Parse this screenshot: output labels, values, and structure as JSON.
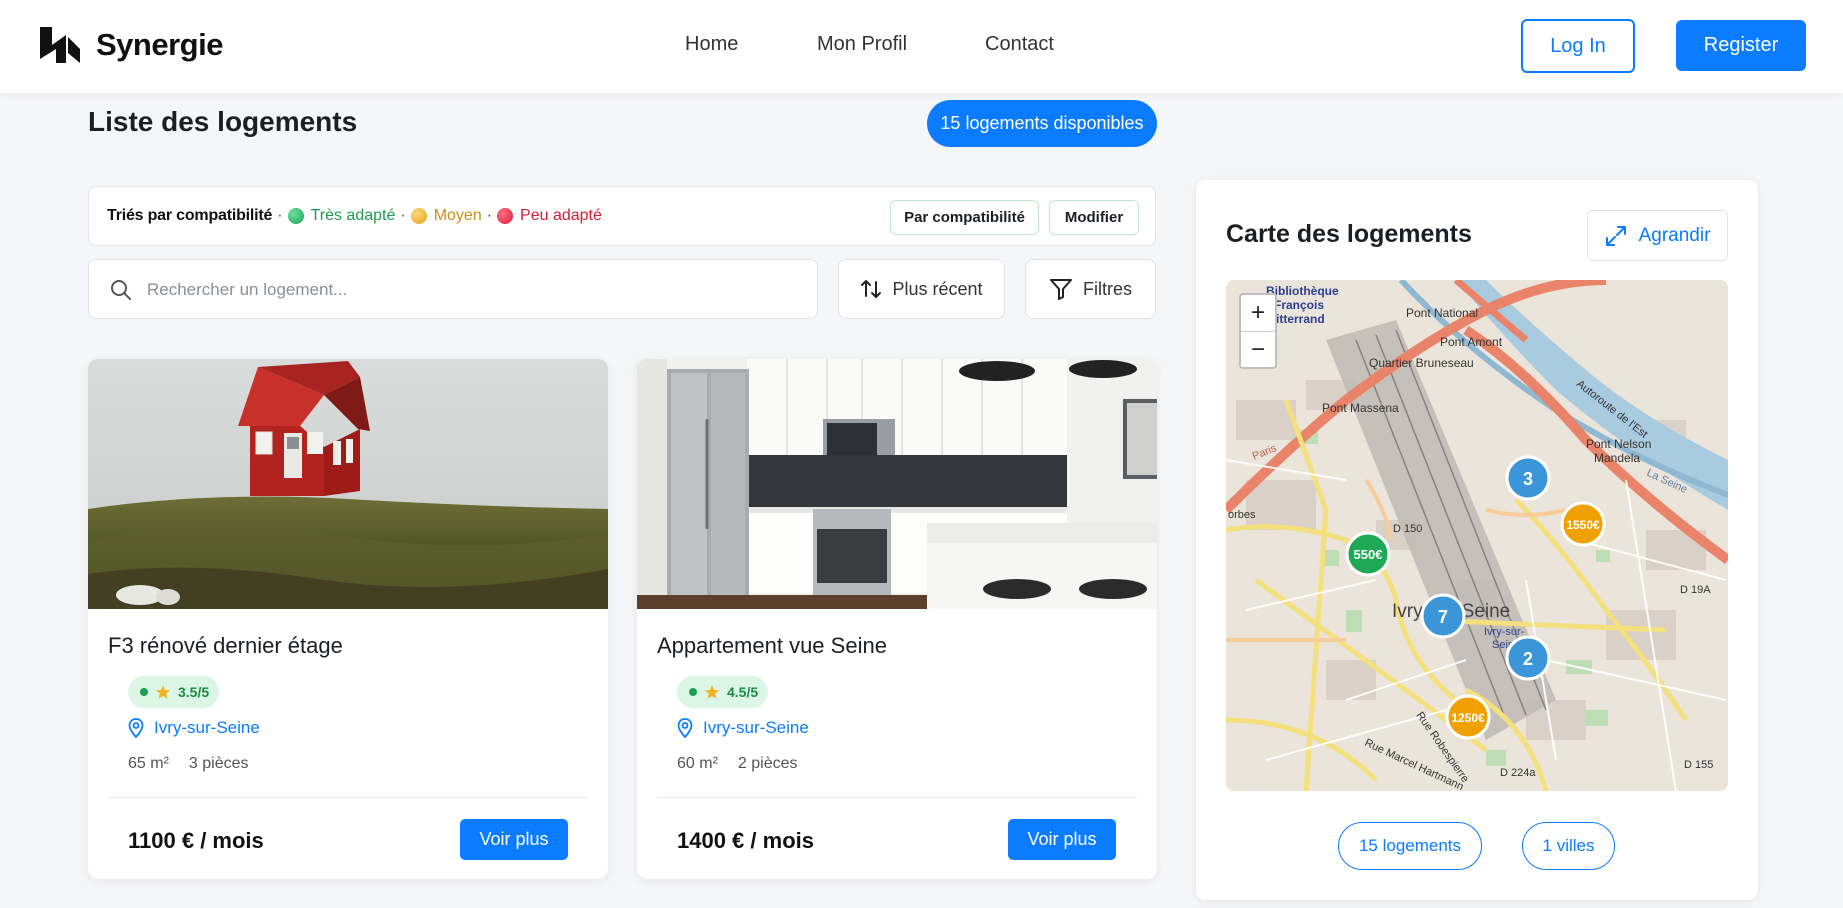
{
  "header": {
    "brand": "Synergie",
    "nav": [
      "Home",
      "Mon Profil",
      "Contact"
    ],
    "login_label": "Log In",
    "register_label": "Register"
  },
  "list": {
    "title": "Liste des logements",
    "count_label": "15 logements disponibles",
    "sort_bar": {
      "lead": "Triés par compatibilité",
      "legend": [
        {
          "label": "Très adapté",
          "color": "#1f9b4e"
        },
        {
          "label": "Moyen",
          "color": "#c8901a"
        },
        {
          "label": "Peu adapté",
          "color": "#d21d36"
        }
      ],
      "chip_compat": "Par compatibilité",
      "chip_modify": "Modifier"
    },
    "search": {
      "placeholder": "Rechercher un logement..."
    },
    "sort_button": "Plus récent",
    "filters_button": "Filtres"
  },
  "cards": [
    {
      "title": "F3 rénové dernier étage",
      "rating": "3.5/5",
      "city": "Ivry-sur-Seine",
      "area": "65 m²",
      "rooms": "3 pièces",
      "price": "1100 € / mois",
      "cta": "Voir plus"
    },
    {
      "title": "Appartement vue Seine",
      "rating": "4.5/5",
      "city": "Ivry-sur-Seine",
      "area": "60 m²",
      "rooms": "2 pièces",
      "price": "1400 € / mois",
      "cta": "Voir plus"
    }
  ],
  "map_panel": {
    "title": "Carte des logements",
    "expand_label": "Agrandir",
    "zoom_in": "+",
    "zoom_out": "−",
    "labels": {
      "bibliotheque_1": "Bibliothèque",
      "bibliotheque_2": "François",
      "bibliotheque_3": "Mitterrand",
      "pont_national": "Pont National",
      "pont_amont": "Pont Amont",
      "quartier": "Quartier Bruneseau",
      "pont_massena": "Pont Massena",
      "autoroute": "Autoroute de l'Est",
      "pont_nelson_1": "Pont Nelson",
      "pont_nelson_2": "Mandela",
      "la_seine": "La Seine",
      "d150": "D 150",
      "d19a": "D 19A",
      "ivry": "Ivry-sur-Seine",
      "ivry_small_1": "Ivry-sur-",
      "ivry_small_2": "Seine",
      "rue_robespierre": "Rue Robespierre",
      "rue_marcel": "Rue Marcel Hartmann",
      "d224a": "D 224a",
      "d155": "D 155",
      "paris": "Paris",
      "orbes": "orbes"
    },
    "markers": [
      {
        "label": "3",
        "kind": "cluster",
        "color": "#3b95d9"
      },
      {
        "label": "1550€",
        "kind": "price",
        "color": "#f0a000"
      },
      {
        "label": "550€",
        "kind": "price",
        "color": "#1fa855"
      },
      {
        "label": "7",
        "kind": "cluster",
        "color": "#3b95d9"
      },
      {
        "label": "2",
        "kind": "cluster",
        "color": "#3b95d9"
      },
      {
        "label": "1250€",
        "kind": "price",
        "color": "#f0a000"
      }
    ],
    "stats": [
      "15 logements",
      "1 villes"
    ]
  }
}
